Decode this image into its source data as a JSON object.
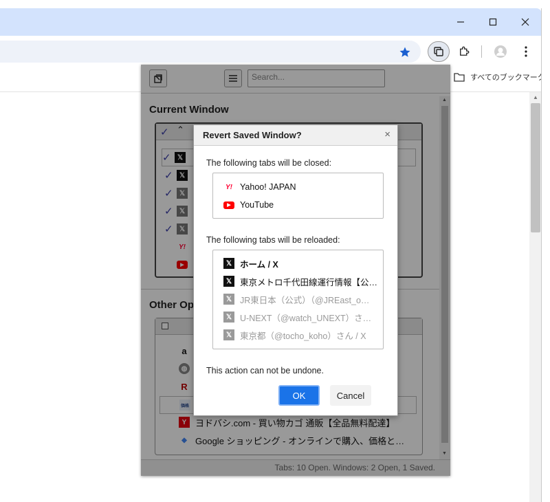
{
  "browser": {
    "bookmark_folder_label": "すべてのブックマーク",
    "icons": [
      "star-icon",
      "tab-search-icon",
      "extensions-icon",
      "profile-icon",
      "menu-dots-icon",
      "minimize-icon",
      "maximize-icon",
      "close-icon",
      "folder-icon"
    ]
  },
  "popup": {
    "search_placeholder": "Search...",
    "current_window_title": "Current Window",
    "other_title": "Other Op",
    "current_rows": [
      {
        "icon": "x-logo-icon"
      },
      {
        "icon": "x-logo-icon"
      },
      {
        "icon": "x-logo-icon"
      },
      {
        "icon": "x-logo-icon"
      },
      {
        "icon": "x-logo-icon"
      },
      {
        "icon": "yahoo-japan-icon"
      },
      {
        "icon": "youtube-icon"
      }
    ],
    "other_rows": [
      {
        "icon": "amazon-icon",
        "text": ""
      },
      {
        "icon": "globe-icon",
        "text": ""
      },
      {
        "icon": "rakuten-icon",
        "text": ""
      },
      {
        "icon": "kakaku-icon",
        "text": ""
      },
      {
        "icon": "yodobashi-icon",
        "text": "ヨドバシ.com - 買い物カゴ 通販【全品無料配達】"
      },
      {
        "icon": "google-shopping-icon",
        "text": "Google ショッピング - オンラインで購入、価格と…"
      }
    ],
    "status": "Tabs: 10 Open. Windows: 2 Open, 1 Saved."
  },
  "dialog": {
    "title": "Revert Saved Window?",
    "close_glyph": "×",
    "closed_label": "The following tabs will be closed:",
    "closed_tabs": [
      {
        "icon": "yahoo-japan-icon",
        "text": "Yahoo! JAPAN"
      },
      {
        "icon": "youtube-icon",
        "text": "YouTube"
      }
    ],
    "reloaded_label": "The following tabs will be reloaded:",
    "reloaded_tabs": [
      {
        "text": "ホーム / X"
      },
      {
        "text": "東京メトロ千代田線運行情報【公…"
      },
      {
        "text": "JR東日本（公式）（@JREast_o…"
      },
      {
        "text": "U-NEXT（@watch_UNEXT）さ…"
      },
      {
        "text": "東京都（@tocho_koho）さん / X"
      }
    ],
    "warning": "This action can not be undone.",
    "ok_label": "OK",
    "cancel_label": "Cancel"
  }
}
